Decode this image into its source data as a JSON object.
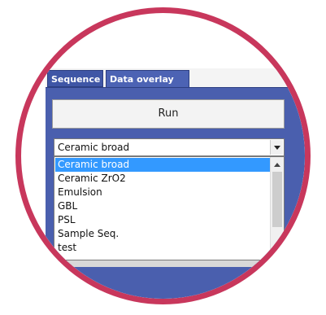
{
  "tabs": {
    "sequence": "Sequence",
    "data_overlay": "Data overlay"
  },
  "run_button": {
    "label": "Run"
  },
  "sequence_select": {
    "value": "Ceramic broad",
    "options": [
      "Ceramic broad",
      "Ceramic ZrO2",
      "Emulsion",
      "GBL",
      "PSL",
      "Sample Seq.",
      "test"
    ],
    "selected_index": 0
  },
  "colors": {
    "ring": "#c8375c",
    "panel": "#4a5fae",
    "highlight": "#3399ff"
  },
  "icons": {
    "dropdown_arrow": "chevron-down-icon",
    "scroll_up": "chevron-up-icon",
    "scroll_down": "chevron-down-icon"
  }
}
